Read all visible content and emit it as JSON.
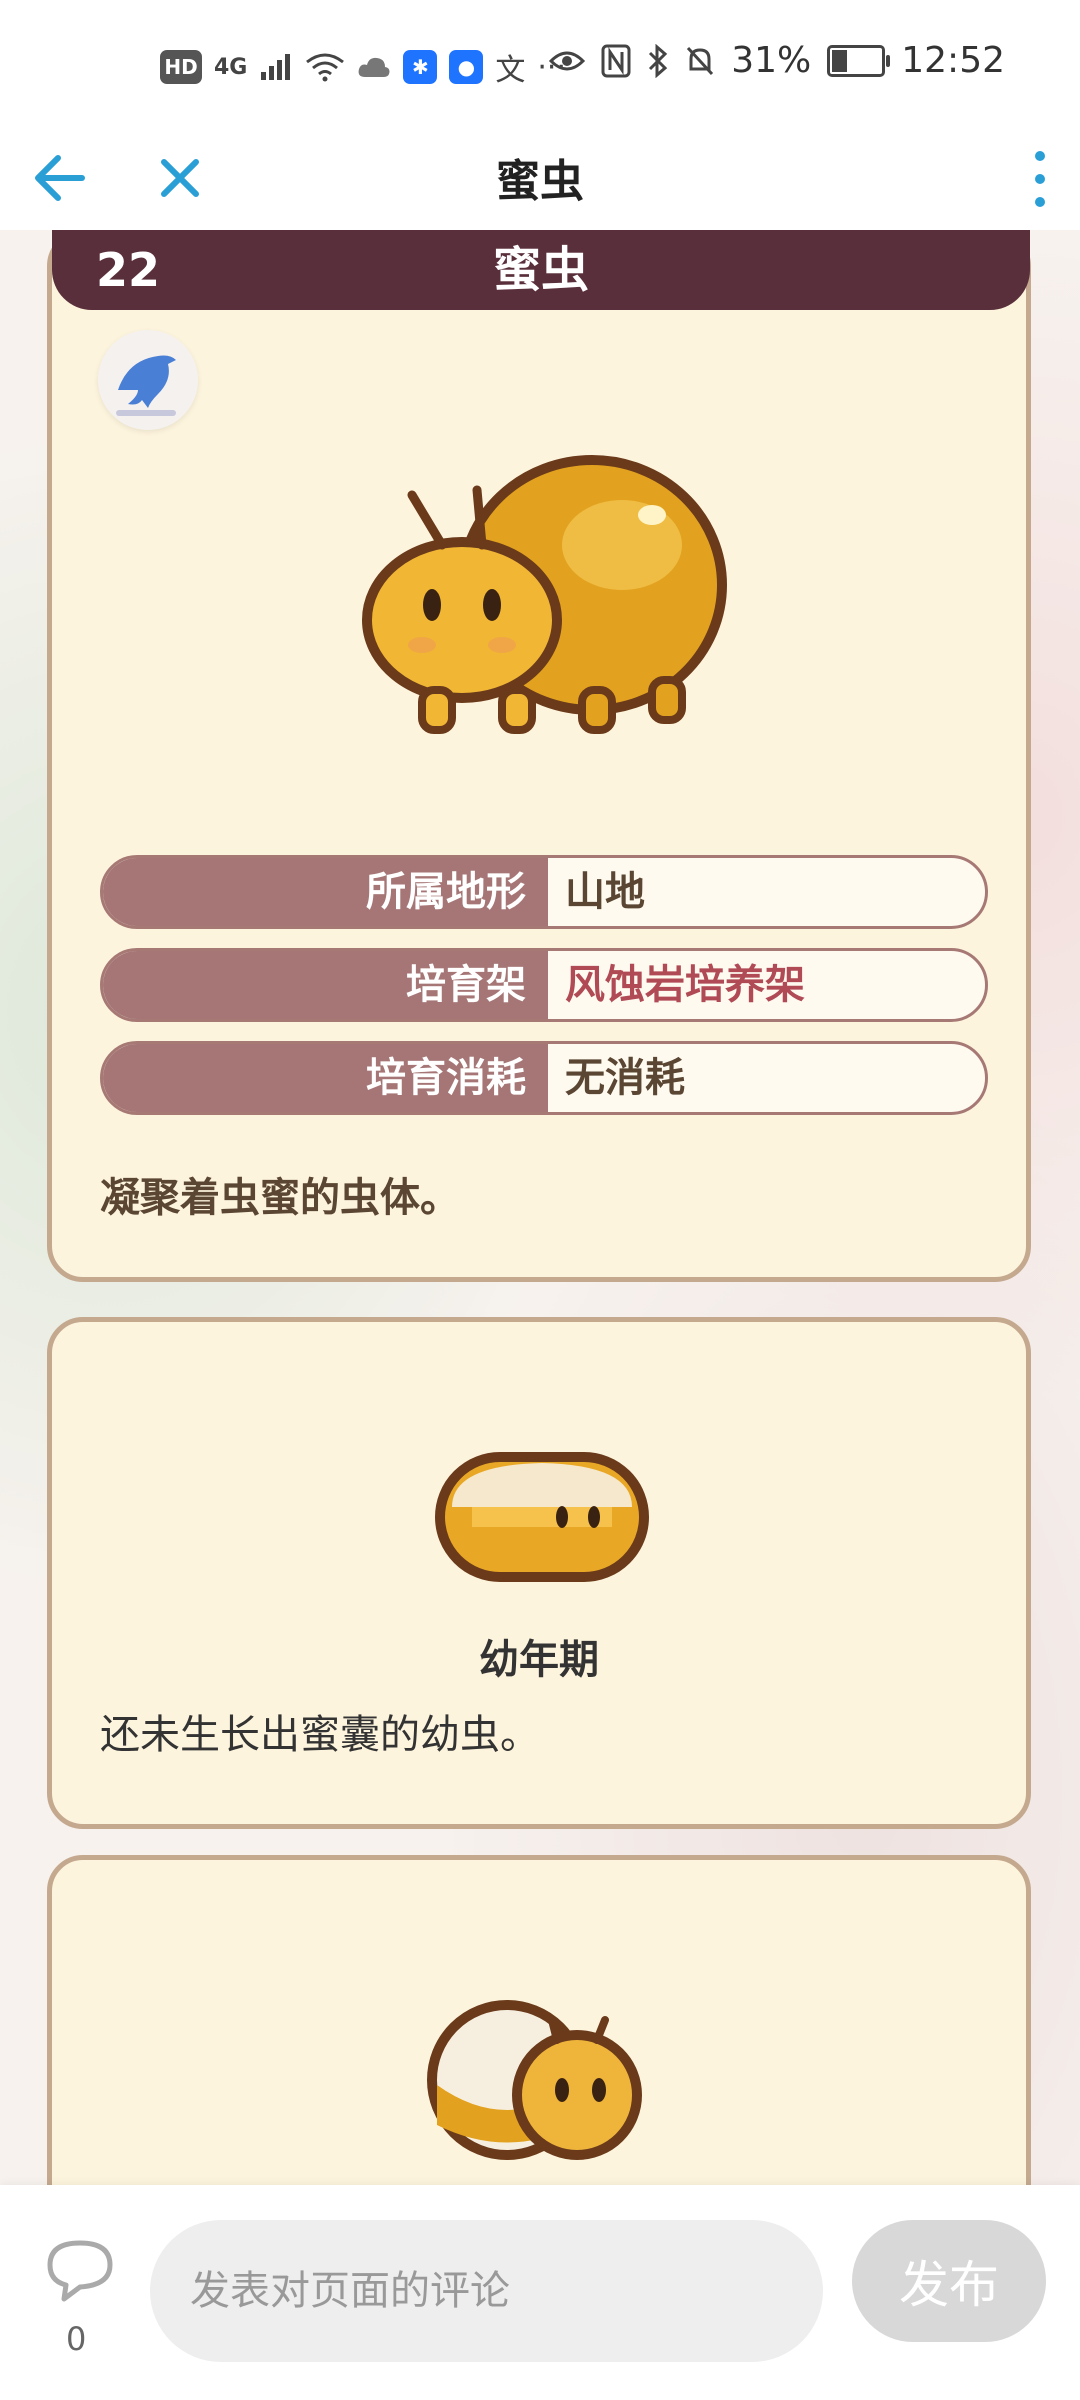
{
  "status_bar": {
    "hd": "HD",
    "network": "4G",
    "battery_percent": "31%",
    "battery_level": 0.31,
    "time": "12:52",
    "icons": [
      "signal-icon",
      "wifi-icon",
      "cloud-icon",
      "app-notification-icon",
      "eye-icon",
      "nfc-icon",
      "bluetooth-icon",
      "mute-icon",
      "battery-icon"
    ]
  },
  "app_bar": {
    "title": "蜜虫",
    "icons": [
      "back-arrow-icon",
      "close-icon",
      "more-vert-icon"
    ]
  },
  "main_card": {
    "number": "22",
    "name": "蜜虫",
    "rows": [
      {
        "label": "所属地形",
        "value": "山地"
      },
      {
        "label": "培育架",
        "value": "风蚀岩培养架"
      },
      {
        "label": "培育消耗",
        "value": "无消耗"
      }
    ],
    "description": "凝聚着虫蜜的虫体。"
  },
  "stages": [
    {
      "name": "幼年期",
      "description": "还未生长出蜜囊的幼虫。"
    }
  ],
  "comment_bar": {
    "count": "0",
    "placeholder": "发表对页面的评论",
    "post_label": "发布"
  },
  "colors": {
    "accent": "#2a9fd6",
    "header": "#5a2f3c",
    "label_bg": "#a67676",
    "card_bg": "#fdf4dd",
    "link_red": "#b04a55"
  }
}
